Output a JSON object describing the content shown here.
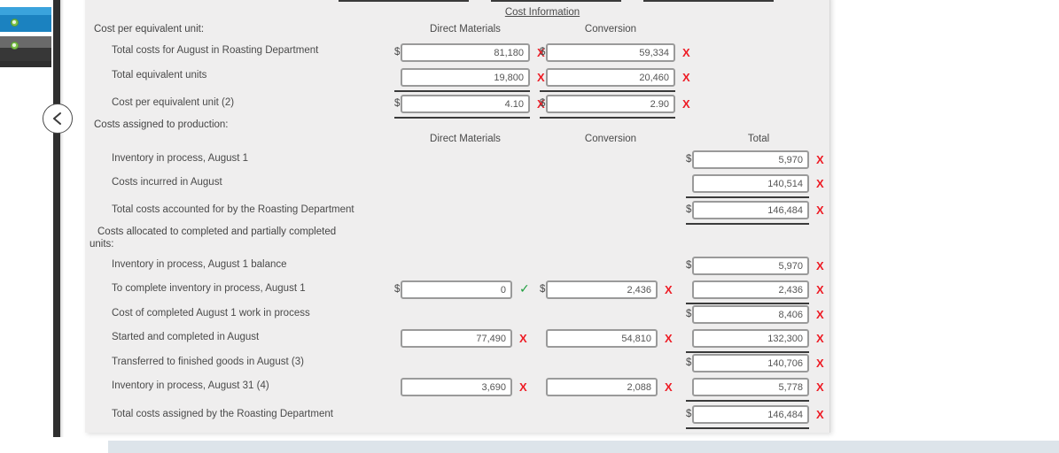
{
  "sidebar": {
    "collapse_icon": "chevron-left-icon",
    "nav_items": [
      {
        "name": "nav-item-blue",
        "status_icon": "green-check-dot"
      },
      {
        "name": "nav-item-gray",
        "status_icon": "green-check-dot"
      }
    ]
  },
  "form": {
    "cost_information_title": "Cost Information",
    "sections": {
      "cost_per_unit_label": "Cost per equivalent unit:",
      "costs_assigned_label": "Costs assigned to production:",
      "costs_allocated_label_line1": "Costs allocated to completed and partially completed",
      "costs_allocated_label_line2": "units:"
    },
    "headers": {
      "direct_materials": "Direct Materials",
      "conversion": "Conversion",
      "total": "Total"
    },
    "rows": {
      "total_costs_august": {
        "label": "Total costs for August in Roasting Department",
        "dm_value": "81,180",
        "dm_mark": "X",
        "cv_value": "59,334",
        "cv_mark": "X"
      },
      "total_equivalent_units": {
        "label": "Total equivalent units",
        "dm_value": "19,800",
        "dm_mark": "X",
        "cv_value": "20,460",
        "cv_mark": "X"
      },
      "cost_per_equivalent_unit": {
        "label": "Cost per equivalent unit (2)",
        "dm_value": "4.10",
        "dm_mark": "X",
        "cv_value": "2.90",
        "cv_mark": "X"
      },
      "inventory_august_1": {
        "label": "Inventory in process, August 1",
        "total_value": "5,970",
        "total_mark": "X"
      },
      "costs_incurred_august": {
        "label": "Costs incurred in August",
        "total_value": "140,514",
        "total_mark": "X"
      },
      "total_costs_accounted": {
        "label": "Total costs accounted for by the Roasting Department",
        "total_value": "146,484",
        "total_mark": "X"
      },
      "inventory_august_1_balance": {
        "label": "Inventory in process, August 1 balance",
        "total_value": "5,970",
        "total_mark": "X"
      },
      "to_complete_inventory": {
        "label": "To complete inventory in process, August 1",
        "dm_value": "0",
        "dm_mark": "✓",
        "cv_value": "2,436",
        "cv_mark": "X",
        "total_value": "2,436",
        "total_mark": "X"
      },
      "cost_of_completed_wip": {
        "label": "Cost of completed August 1 work in process",
        "total_value": "8,406",
        "total_mark": "X"
      },
      "started_and_completed": {
        "label": "Started and completed in August",
        "dm_value": "77,490",
        "dm_mark": "X",
        "cv_value": "54,810",
        "cv_mark": "X",
        "total_value": "132,300",
        "total_mark": "X"
      },
      "transferred_to_finished_goods": {
        "label": "Transferred to finished goods in August (3)",
        "total_value": "140,706",
        "total_mark": "X"
      },
      "inventory_august_31": {
        "label": "Inventory in process, August 31 (4)",
        "dm_value": "3,690",
        "dm_mark": "X",
        "cv_value": "2,088",
        "cv_mark": "X",
        "total_value": "5,778",
        "total_mark": "X"
      },
      "total_costs_assigned": {
        "label": "Total costs assigned by the Roasting Department",
        "total_value": "146,484",
        "total_mark": "X"
      }
    },
    "currency_symbol": "$"
  },
  "colors": {
    "panel_bg": "#efeeee",
    "wrong_mark": "#ee1c25",
    "right_mark": "#1e9e3e",
    "nav_blue": "#1b82c0",
    "nav_gray": "#373737",
    "status_green": "#7ec44b",
    "bottom_bar": "#dde4ea"
  }
}
